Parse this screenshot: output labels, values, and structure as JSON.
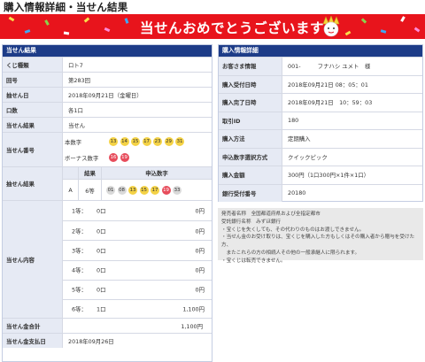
{
  "page": {
    "title": "購入情報詳細・当せん結果"
  },
  "banner": {
    "text": "当せんおめでとうございます!!"
  },
  "result": {
    "header": "当せん結果",
    "rows": {
      "kuji_label": "くじ種類",
      "kuji_value": "ロト7",
      "round_label": "回号",
      "round_value": "第283回",
      "date_label": "抽せん日",
      "date_value": "2018年09月21日（金曜日）",
      "units_label": "口数",
      "units_value": "各1口",
      "outcome_label": "当せん結果",
      "outcome_value": "当せん",
      "winning_label": "当せん番号",
      "main_label": "本数字",
      "main_numbers": [
        "13",
        "14",
        "15",
        "17",
        "23",
        "29",
        "31"
      ],
      "bonus_label": "ボーナス数字",
      "bonus_numbers": [
        "16",
        "19"
      ]
    },
    "draw": {
      "label": "抽せん結果",
      "col_result": "結果",
      "col_numbers": "申込数字",
      "line": "A",
      "line_result": "6等",
      "numbers": [
        {
          "n": "01",
          "c": "gray"
        },
        {
          "n": "08",
          "c": "gray"
        },
        {
          "n": "13",
          "c": "yellow"
        },
        {
          "n": "15",
          "c": "yellow"
        },
        {
          "n": "17",
          "c": "yellow"
        },
        {
          "n": "19",
          "c": "red"
        },
        {
          "n": "33",
          "c": "gray"
        }
      ]
    },
    "content": {
      "label": "当せん内容",
      "tiers": [
        {
          "tier": "1等：",
          "count": "0口",
          "amount": "0円"
        },
        {
          "tier": "2等：",
          "count": "0口",
          "amount": "0円"
        },
        {
          "tier": "3等：",
          "count": "0口",
          "amount": "0円"
        },
        {
          "tier": "4等：",
          "count": "0口",
          "amount": "0円"
        },
        {
          "tier": "5等：",
          "count": "0口",
          "amount": "0円"
        },
        {
          "tier": "6等：",
          "count": "1口",
          "amount": "1,100円"
        }
      ]
    },
    "total_label": "当せん金合計",
    "total_value": "1,100円",
    "payday_label": "当せん金支払日",
    "payday_value": "2018年09月26日"
  },
  "purchase": {
    "header": "購入情報詳細",
    "rows": [
      {
        "label": "お客さま情報",
        "value": "001-　　　フナハシ ユメト　様"
      },
      {
        "label": "購入受付日時",
        "value": "2018年09月21日 08：05：01"
      },
      {
        "label": "購入完了日時",
        "value": "2018年09月21日　10：59：03"
      },
      {
        "label": "取引ID",
        "value": "180"
      },
      {
        "label": "購入方法",
        "value": "定期購入"
      },
      {
        "label": "申込数字選択方式",
        "value": "クイックピック"
      },
      {
        "label": "購入金額",
        "value": "300円（1口300円×1件×1口）"
      },
      {
        "label": "銀行受付番号",
        "value": "20180"
      }
    ]
  },
  "notes": [
    "発売者名称　全国都道府県および全指定都市",
    "受託銀行名称　みずほ銀行",
    "・宝くじを失くしても、その代わりのものはお渡しできません。",
    "・当せん金のお受け取りは、宝くじを購入した方もしくはその購入者から贈与を受けた方、",
    "　またこれらの方の相続人その他の一般承継人に限られます。",
    "・宝くじは転売できません。"
  ],
  "colors": {
    "header_bg": "#1d3c88",
    "banner_bg": "#e8141c",
    "label_bg": "#e6eaf4",
    "ball_yellow": "#f4d245",
    "ball_red": "#e74c5b",
    "ball_gray": "#d9d9d9"
  }
}
